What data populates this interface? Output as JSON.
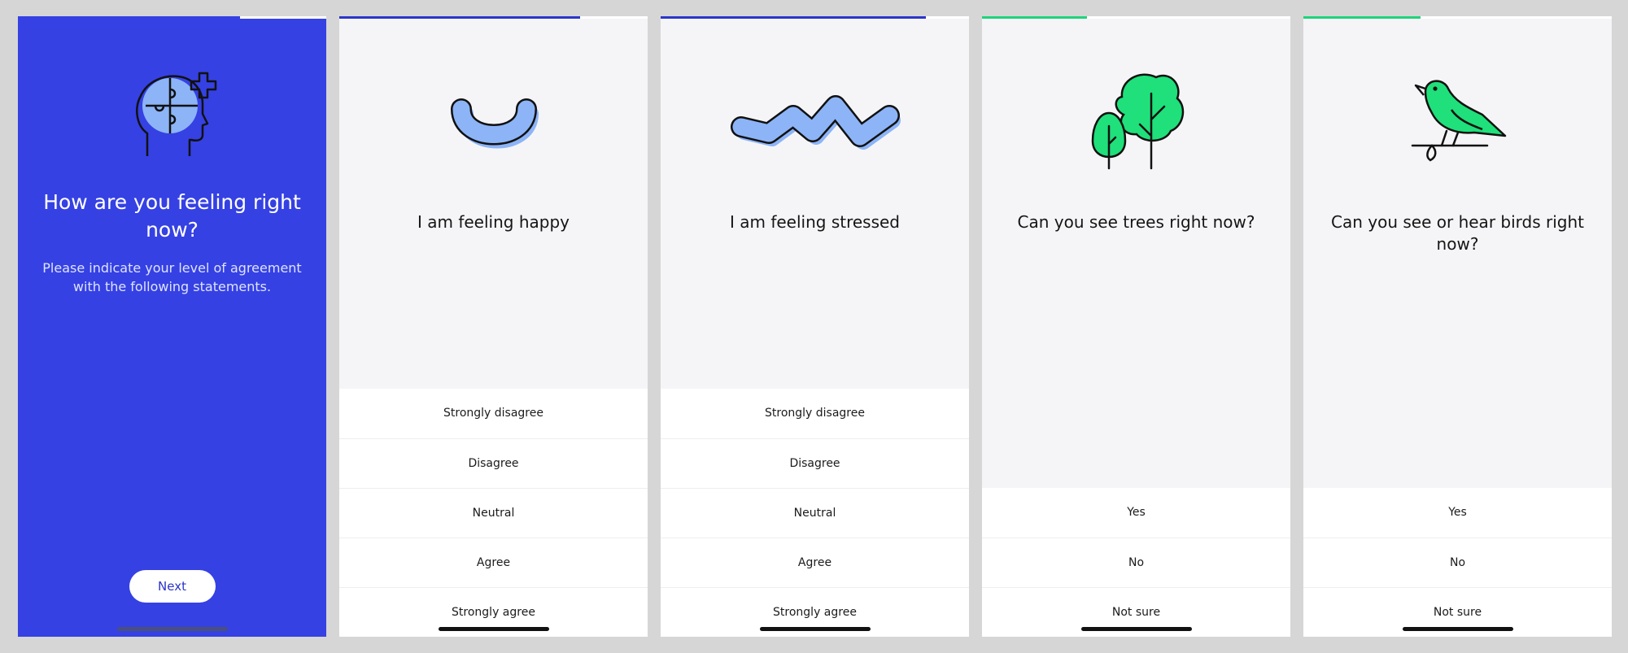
{
  "colors": {
    "primary": "#3541e3",
    "progress_blue": "#2b35c9",
    "progress_green": "#1fd37a",
    "illustration_blue": "#8cb4f7",
    "illustration_green": "#1fe07a"
  },
  "screens": [
    {
      "type": "intro",
      "progress": 0.72,
      "icon": "head-puzzle-icon",
      "title": "How are you feeling right now?",
      "subtitle": "Please indicate your level of agreement with the following statements.",
      "next_label": "Next"
    },
    {
      "type": "likert",
      "progress": 0.78,
      "icon": "smile-arc-icon",
      "question": "I am feeling happy",
      "options": [
        "Strongly disagree",
        "Disagree",
        "Neutral",
        "Agree",
        "Strongly agree"
      ]
    },
    {
      "type": "likert",
      "progress": 0.86,
      "icon": "zigzag-icon",
      "question": "I am feeling stressed",
      "options": [
        "Strongly disagree",
        "Disagree",
        "Neutral",
        "Agree",
        "Strongly agree"
      ]
    },
    {
      "type": "choice",
      "progress": 0.34,
      "icon": "trees-icon",
      "question": "Can you see trees right now?",
      "options": [
        "Yes",
        "No",
        "Not sure"
      ]
    },
    {
      "type": "choice",
      "progress": 0.38,
      "icon": "bird-icon",
      "question": "Can you see or hear birds right now?",
      "options": [
        "Yes",
        "No",
        "Not sure"
      ]
    }
  ]
}
